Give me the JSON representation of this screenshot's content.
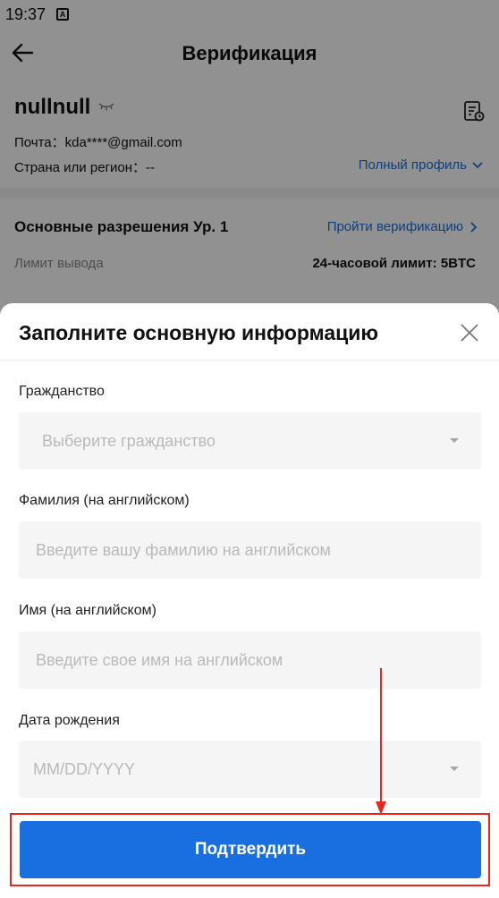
{
  "statusbar": {
    "time": "19:37",
    "notif": "A"
  },
  "appbar": {
    "title": "Верификация",
    "back_icon": "arrow-left-icon"
  },
  "profile": {
    "name": "nullnull",
    "email": "Почта：kda****@gmail.com",
    "country": "Страна или регион：--",
    "full_profile": "Полный профиль"
  },
  "permissions": {
    "label": "Основные разрешения Ур. 1",
    "verify_link": "Пройти верификацию",
    "limit_label": "Лимит вывода",
    "limit_value": "24-часовой лимит: 5BTC"
  },
  "sheet": {
    "title": "Заполните основную информацию",
    "fields": [
      {
        "label": "Гражданство",
        "placeholder": "Выберите гражданство",
        "type": "select"
      },
      {
        "label": "Фамилия (на английском)",
        "placeholder": "Введите вашу фамилию на английском",
        "type": "text"
      },
      {
        "label": "Имя (на английском)",
        "placeholder": "Введите свое имя на английском",
        "type": "text"
      },
      {
        "label": "Дата рождения",
        "placeholder": "MM/DD/YYYY",
        "type": "select"
      }
    ],
    "submit": "Подтвердить"
  },
  "colors": {
    "accent": "#1a6fe0",
    "annotation": "#e8261e"
  }
}
